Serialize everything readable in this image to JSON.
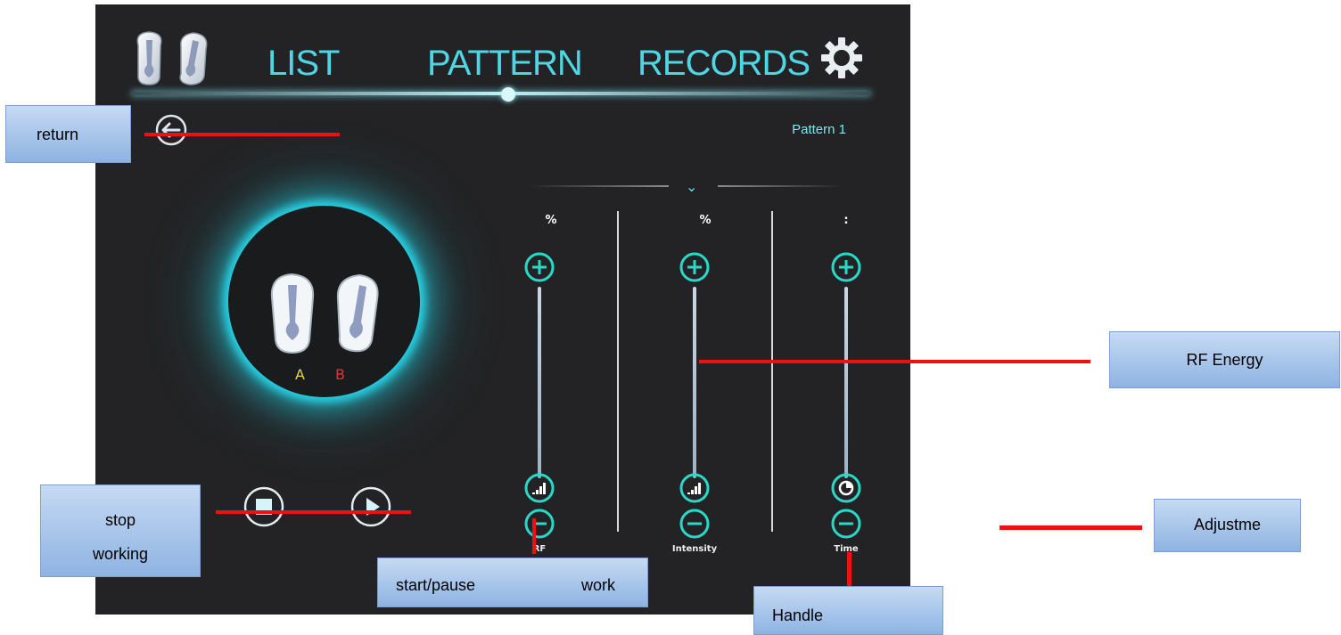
{
  "nav": {
    "tabs": [
      {
        "label": "LIST"
      },
      {
        "label": "PATTERN"
      },
      {
        "label": "RECORDS"
      }
    ],
    "handpiece_icon": "dual-handpiece-icon",
    "settings_icon": "gear-icon"
  },
  "pattern": {
    "name": "Pattern 1",
    "return_icon": "back-arrow-icon"
  },
  "device": {
    "label_a": "A",
    "label_b": "B"
  },
  "controls": {
    "stop_icon": "stop-icon",
    "play_icon": "play-icon",
    "columns": [
      {
        "unit": "%",
        "label": "RF",
        "level_icon": "signal-bars-icon"
      },
      {
        "unit": "%",
        "label": "Intensity",
        "level_icon": "signal-bars-icon"
      },
      {
        "unit": ":",
        "label": "Time",
        "level_icon": "timer-icon"
      }
    ]
  },
  "annotations": {
    "return": "return",
    "stop_working": [
      "stop",
      "working"
    ],
    "start_pause_work": [
      "start/pause",
      "work"
    ],
    "rf_energy": "RF Energy",
    "adjustme": "Adjustme",
    "handle": "Handle"
  },
  "colors": {
    "accent": "#4fd6e4",
    "glow": "#27d3e6",
    "screen": "#232325",
    "callout_line": "#ee1111"
  }
}
